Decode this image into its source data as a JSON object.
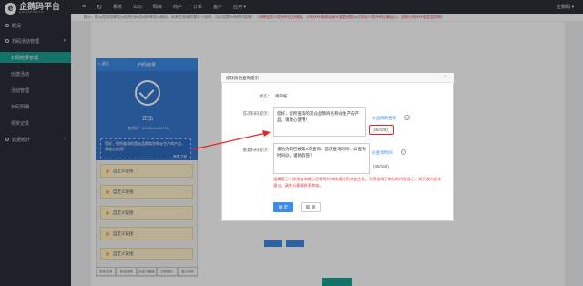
{
  "brand": {
    "name": "企鹅码平台",
    "subtitle": "QIEMAPINGTAI"
  },
  "sidebar": {
    "items": [
      {
        "label": "概况"
      },
      {
        "label": "扫码活动管理",
        "children": [
          "扫码结果管理",
          "创建活动",
          "活动管理",
          "扫码明细",
          "领奖记录"
        ]
      },
      {
        "label": "数据统计"
      }
    ]
  },
  "topbar": {
    "items": [
      "系统",
      "公司",
      "码库",
      "商户",
      "订单",
      "客户",
      "应用 ▾"
    ],
    "user": "企鹅码 ▾"
  },
  "notice": {
    "text": "提示：提示信息用来提示您的扫码活动结果显示情况，如未生效请检查以下说明，可以设置不同的内容哦！",
    "red": "（如果您是小程序的官方模版，小程序环境建议请不要更改提示以保证小程序的正确运行，否则小程序环境会受影响）"
  },
  "phone": {
    "title": "扫码结果",
    "back": "< 返回",
    "result_word": "正品",
    "code_line": "查询码：5645649484789",
    "message": "您好，您所查询的是@品牌商名称@生产的产品，请放心使用！",
    "hero_actions": "审核  立即",
    "cards": [
      "自定义链接",
      "自定义链接",
      "自定义链接",
      "自定义链接",
      "自定义链接"
    ],
    "tabs": [
      "防伪查询",
      "商品溯源",
      "自定义链接",
      "扫码图片",
      "显示代码"
    ]
  },
  "dialog": {
    "title": "修改防伪查询提示",
    "close": "×",
    "status_label": "状态：",
    "status_value": "待审核",
    "first_label": "首次扫码提示：",
    "first_text": "您好，您所查询的是@品牌商名称@生产的产品，请放心使用！",
    "first_tag": "@品牌商名称",
    "first_count": "(28/100)",
    "repeat_label": "重复扫码提示：",
    "repeat_text": "该防伪码已被第X次查询，首次查询时间：@查询时间@，谨防假冒！",
    "repeat_tag": "@查询时间",
    "repeat_count": "(35/100)",
    "help": "?",
    "tip": "温馨提示：修改查询提示后需等待审核通过后才会生效，可预览用于审核的内容显示，如更改内容未通过，请先与客服联系审核。",
    "ok": "确 定",
    "cancel": "取 消"
  }
}
